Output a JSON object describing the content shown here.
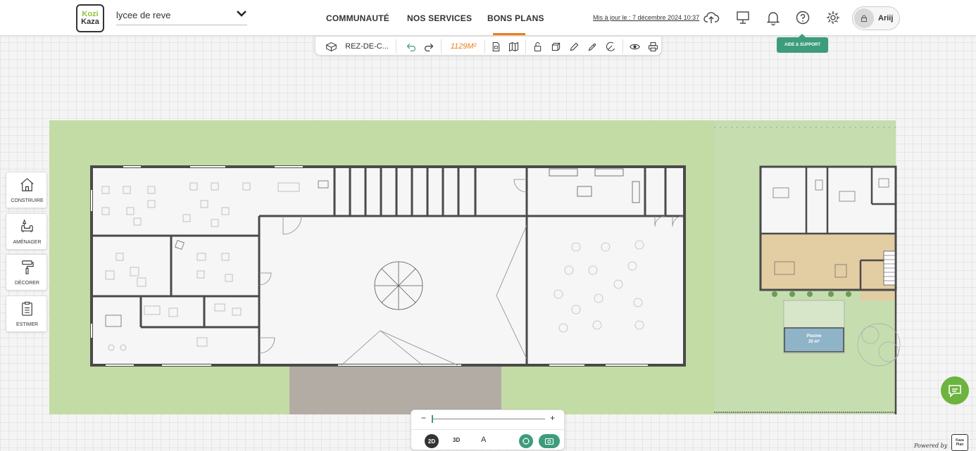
{
  "header": {
    "logo_line1": "Kozi",
    "logo_line2": "Kaza",
    "project_name": "lycee de reve",
    "nav": {
      "community": "COMMUNAUTÉ",
      "services": "NOS SERVICES",
      "deals": "BONS PLANS"
    },
    "updated_text": "Mis à jour le : 7 décembre 2024 10:37",
    "user_name": "Ariij",
    "tooltip": "AIDE & SUPPORT"
  },
  "toolbar": {
    "floor": "REZ-DE-C...",
    "area": "1129M²"
  },
  "sidebar": {
    "items": [
      {
        "label": "CONSTRUIRE",
        "icon": "house-icon"
      },
      {
        "label": "AMÉNAGER",
        "icon": "sofa-lamp-icon"
      },
      {
        "label": "DÉCORER",
        "icon": "paint-roller-icon"
      },
      {
        "label": "ESTIMER",
        "icon": "clipboard-icon"
      }
    ]
  },
  "plan": {
    "pool_label": "Piscine",
    "pool_area": "20 m²"
  },
  "view": {
    "zoom_minus": "−",
    "zoom_plus": "+",
    "mode_2d": "2D",
    "mode_3d": "3D",
    "mode_a": "A"
  },
  "footer": {
    "powered_by": "Powered by",
    "powered_logo": "Kaza Plan"
  },
  "colors": {
    "accent_green": "#3d9c7c",
    "accent_orange": "#f07d1a",
    "lawn": "#c3dca6",
    "terrace": "#e3cda3",
    "pool": "#8fb4c8"
  }
}
